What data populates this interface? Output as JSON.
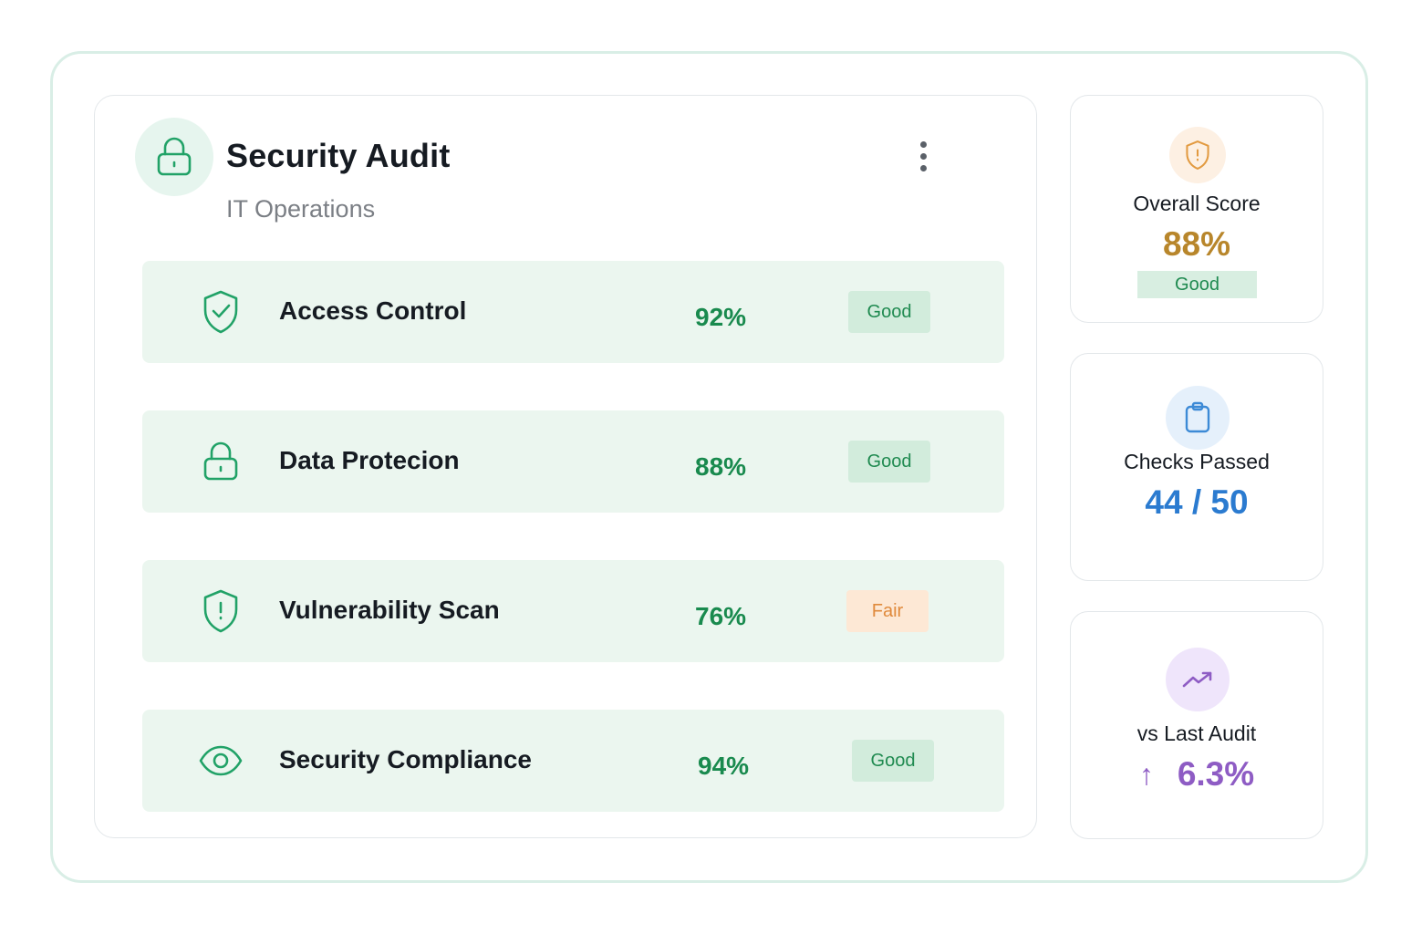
{
  "header": {
    "title": "Security Audit",
    "subtitle": "IT Operations",
    "icon": "lock-icon",
    "menu_icon": "more-vertical-icon"
  },
  "rows": [
    {
      "label": "Access Control",
      "value": "92%",
      "status": "Good",
      "icon": "shield-check-icon"
    },
    {
      "label": "Data Protecion",
      "value": "88%",
      "status": "Good",
      "icon": "lock-icon"
    },
    {
      "label": "Vulnerability Scan",
      "value": "76%",
      "status": "Fair",
      "icon": "shield-alert-icon"
    },
    {
      "label": "Security Compliance",
      "value": "94%",
      "status": "Good",
      "icon": "eye-icon"
    }
  ],
  "summary": {
    "overall": {
      "label": "Overall Score",
      "value": "88%",
      "badge": "Good",
      "icon": "shield-alert-icon",
      "color": "#b8862b"
    },
    "checks": {
      "label": "Checks Passed",
      "value": "44 / 50",
      "icon": "clipboard-icon",
      "color": "#2b7bd0"
    },
    "trend": {
      "label": "vs Last Audit",
      "arrow": "↑",
      "value": "6.3%",
      "icon": "trending-up-icon",
      "color": "#8e5cc4"
    }
  },
  "colors": {
    "accent_green": "#198a4e",
    "row_background": "#ebf6ef",
    "badge_good": "#d2ecdc",
    "badge_fair": "#fde8d5",
    "frame_border": "#d9eee6"
  }
}
